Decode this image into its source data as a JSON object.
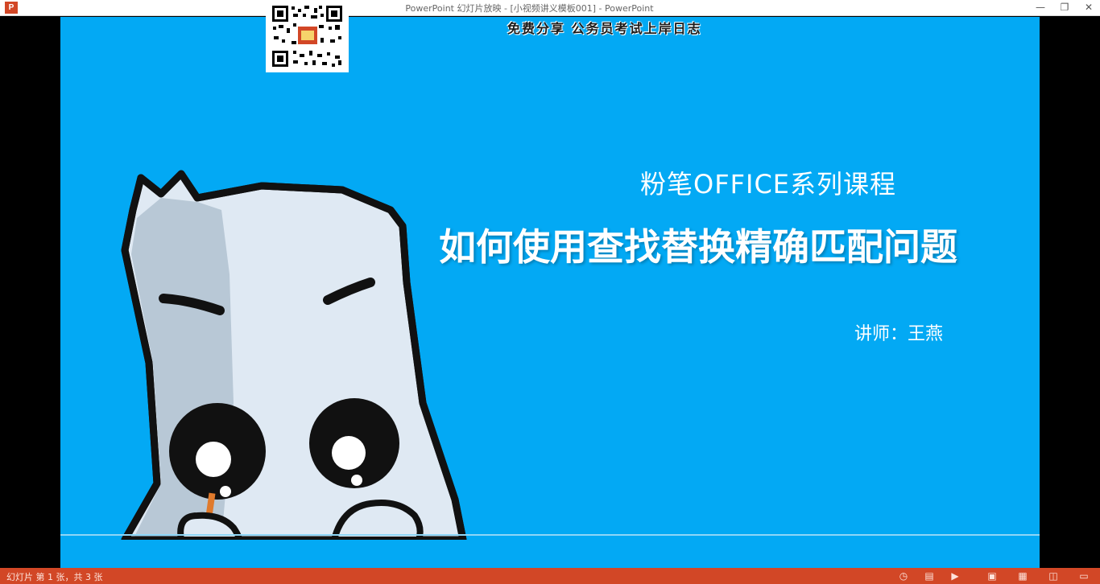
{
  "window": {
    "app_icon_letter": "P",
    "title": "PowerPoint 幻灯片放映 - [小视频讲义模板001] - PowerPoint",
    "minimize": "—",
    "restore": "❐",
    "close": "✕"
  },
  "overlay": {
    "watermark": "免费分享 公务员考试上岸日志"
  },
  "slide": {
    "background_color": "#03a9f4",
    "series_title": "粉笔OFFICE系列课程",
    "main_title": "如何使用查找替换精确匹配问题",
    "instructor": "讲师：王燕"
  },
  "statusbar": {
    "color": "#d24726",
    "slide_counter": "幻灯片 第 1 张，共 3 张",
    "icons": [
      "pointer-icon",
      "notes-icon",
      "play-icon",
      "normal-view-icon",
      "slide-sorter-icon",
      "reading-view-icon",
      "slideshow-icon"
    ]
  }
}
